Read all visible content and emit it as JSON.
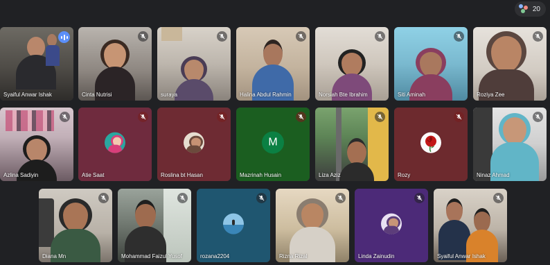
{
  "participants_count": "20",
  "colors": {
    "background": "#202124",
    "tile_default": "#3c4043",
    "speaking_blue": "#5b8ff9",
    "letter_avatar_green": "#0b8043"
  },
  "tiles": [
    {
      "name": "Syaiful Anwar Ishak",
      "icon": "speaking-indicator-icon"
    },
    {
      "name": "Cinta Nutrisi",
      "icon": "mic-off-icon"
    },
    {
      "name": "suraya",
      "icon": "mic-off-icon"
    },
    {
      "name": "Halina Abdul Rahmin",
      "icon": "mic-off-icon"
    },
    {
      "name": "Norsiah Bte Ibrahim",
      "icon": "mic-off-icon"
    },
    {
      "name": "Siti Aminah",
      "icon": "mic-off-icon"
    },
    {
      "name": "Roziya Zee",
      "icon": "mic-off-icon"
    },
    {
      "name": "Azlina Sadiyin",
      "icon": "mic-off-icon"
    },
    {
      "name": "Atie Saat",
      "icon": "mic-off-icon"
    },
    {
      "name": "Roslina bt Hasan",
      "icon": "mic-off-icon"
    },
    {
      "name": "Mazrinah Husain",
      "icon": "mic-off-icon",
      "avatar_letter": "M"
    },
    {
      "name": "Liza Aziz",
      "icon": "mic-off-icon"
    },
    {
      "name": "Rozy",
      "icon": "mic-off-icon"
    },
    {
      "name": "Ninaz Ahmad",
      "icon": "mic-off-icon"
    },
    {
      "name": "Diana Mn",
      "icon": "mic-off-icon"
    },
    {
      "name": "Mohammad Faizul Yusof",
      "icon": "mic-off-icon"
    },
    {
      "name": "rozana2204",
      "icon": "mic-off-icon"
    },
    {
      "name": "Rizna Rizal",
      "icon": "mic-off-icon"
    },
    {
      "name": "Linda Zainudin",
      "icon": "mic-off-icon"
    },
    {
      "name": "Syaiful Anwar Ishak",
      "icon": "mic-off-icon"
    }
  ]
}
